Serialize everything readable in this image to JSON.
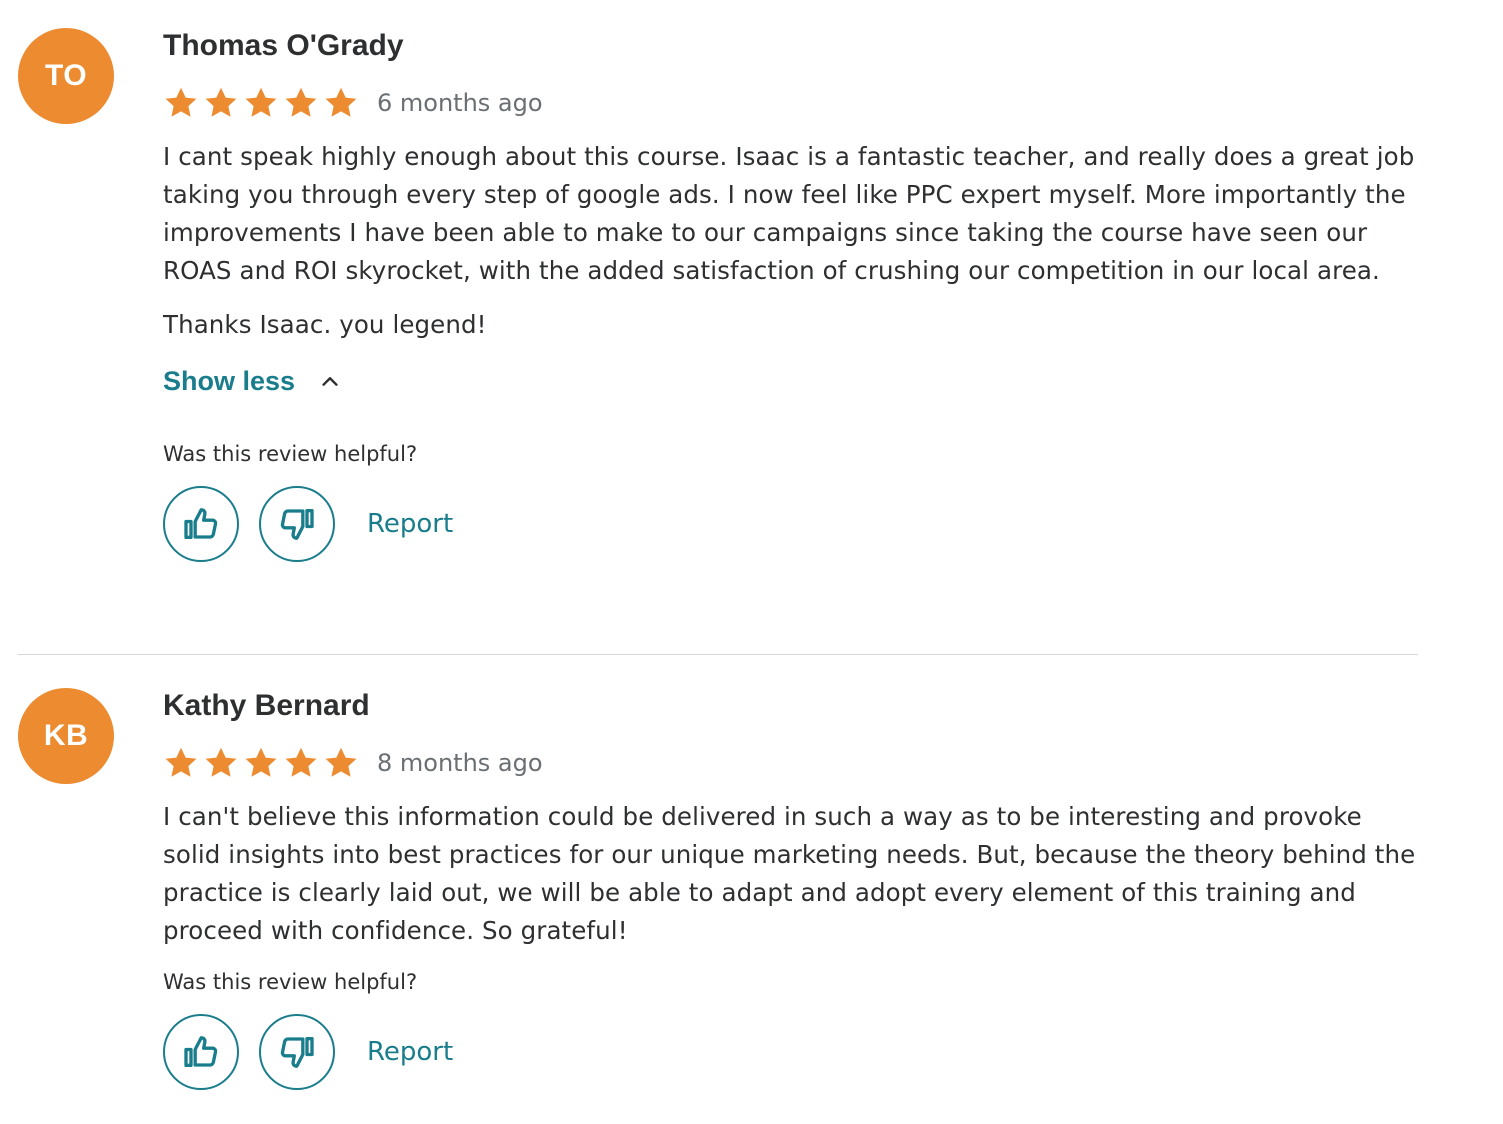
{
  "reviews": [
    {
      "initials": "TO",
      "name": "Thomas O'Grady",
      "rating": 5,
      "time": "6 months ago",
      "paragraphs": [
        "I cant speak highly enough about this course. Isaac is a fantastic teacher, and really does a great job taking you through every step of google ads. I now feel like PPC expert myself. More importantly the improvements I have been able to make to our campaigns since taking the course have seen our ROAS and ROI skyrocket, with the added satisfaction of crushing our competition in our local area.",
        "Thanks Isaac. you legend!"
      ],
      "toggle_label": "Show less",
      "helpful_label": "Was this review helpful?",
      "report_label": "Report"
    },
    {
      "initials": "KB",
      "name": "Kathy Bernard",
      "rating": 5,
      "time": "8 months ago",
      "paragraphs": [
        "I can't believe this information could be delivered in such a way as to be interesting and provoke solid insights into best practices for our unique marketing needs. But, because the theory behind the practice is clearly laid out, we will be able to adapt and adopt every element of this training and proceed with confidence. So grateful!"
      ],
      "helpful_label": "Was this review helpful?",
      "report_label": "Report"
    }
  ],
  "colors": {
    "avatar_bg": "#ec8b30",
    "star": "#ec8b30",
    "accent": "#1a7d8c",
    "divider": "#d1d7dc"
  },
  "icons": {
    "thumbs_up": "thumbs-up-icon",
    "thumbs_down": "thumbs-down-icon",
    "chevron": "chevron-up-icon",
    "star": "star-icon"
  }
}
